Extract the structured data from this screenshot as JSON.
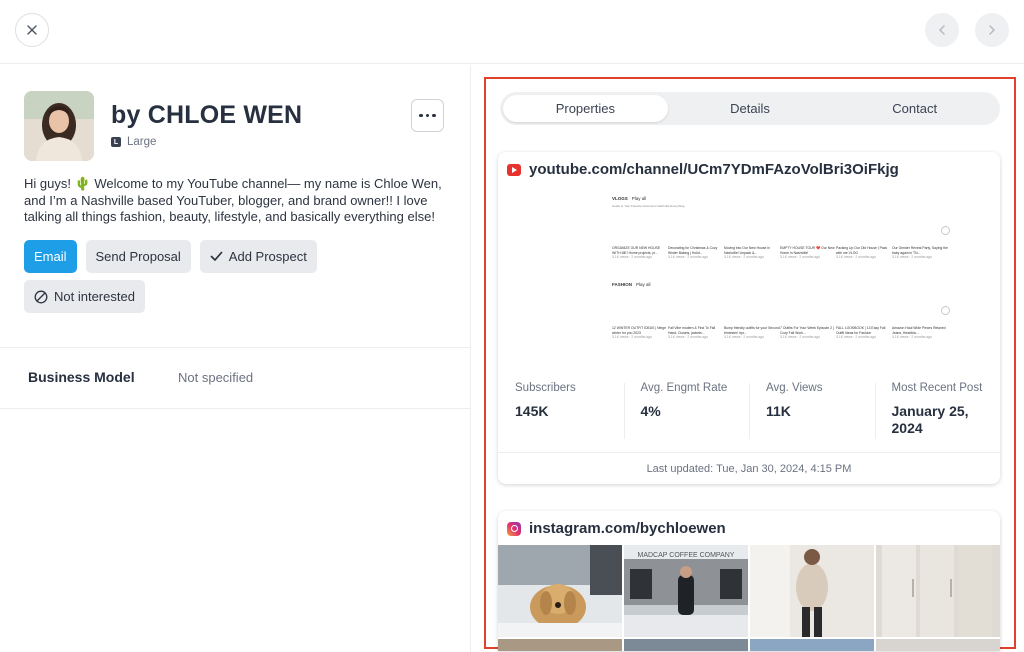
{
  "profile": {
    "name": "by CHLOE WEN",
    "size_badge": "L",
    "size": "Large",
    "bio": "Hi guys! 🌵 Welcome to my YouTube channel— my name is Chloe Wen, and I’m a Nashville based YouTuber, blogger, and brand owner!! I love talking all things fashion, beauty, lifestyle, and basically everything else!"
  },
  "actions": {
    "email": "Email",
    "send_proposal": "Send Proposal",
    "add_prospect": "Add Prospect",
    "not_interested": "Not interested"
  },
  "business_model": {
    "label": "Business Model",
    "value": "Not specified"
  },
  "tabs": [
    {
      "label": "Properties",
      "active": true
    },
    {
      "label": "Details",
      "active": false
    },
    {
      "label": "Contact",
      "active": false
    }
  ],
  "youtube": {
    "url": "youtube.com/channel/UCm7YDmFAzoVolBri3OiFkjg",
    "preview": {
      "section1": "VLOGS",
      "section1_sub": "Guide to Your Favorite Ascension Nashville Everything",
      "section2": "FASHION",
      "play_all": "Play all",
      "row1": [
        "ORGANIZE OUR NEW HOUSE WITH ME! Home projects, pl...",
        "Decorating for Christmas & Cozy Winter Baking | Holid...",
        "Moving into Our New House in Nashville! Unpack &...",
        "EMPTY HOUSE TOUR ❤️ Our New Home in Nashville!",
        "Packing Up Our Old House | Pack with me VLOG",
        "Our Gender Reveal Party, Saying the baby again in TN..."
      ],
      "row2": [
        "12 WINTER OUTFIT IDEAS | Neige winter for you 2023",
        "Fall Vibe modern & Find To Fall Hand, Closets, jackets...",
        "Bump friendly outfits for your Second trimester! #pr...",
        "7 Outfits For Your Week Episode 2 | Cozy Fall Work...",
        "FALL LOOKBOOK | 13 Easy Fall Outfit Ideas for Fashion",
        "Amazon Haul Wide Pieces Relaxed Jeans, Heartbla..."
      ],
      "meta": "3.1K views · 2 months ago"
    },
    "stats": [
      {
        "label": "Subscribers",
        "value": "145K"
      },
      {
        "label": "Avg. Engmt Rate",
        "value": "4%"
      },
      {
        "label": "Avg. Views",
        "value": "11K"
      },
      {
        "label": "Most Recent Post",
        "value": "January 25, 2024"
      }
    ],
    "updated": "Last updated: Tue, Jan 30, 2024, 4:15 PM"
  },
  "instagram": {
    "url": "instagram.com/bychloewen",
    "photo_sign_text": "MADCAP COFFEE COMPANY"
  },
  "colors": {
    "accent": "#1f9ee8",
    "highlight_border": "#e0412c",
    "youtube_red": "#e8322d"
  }
}
